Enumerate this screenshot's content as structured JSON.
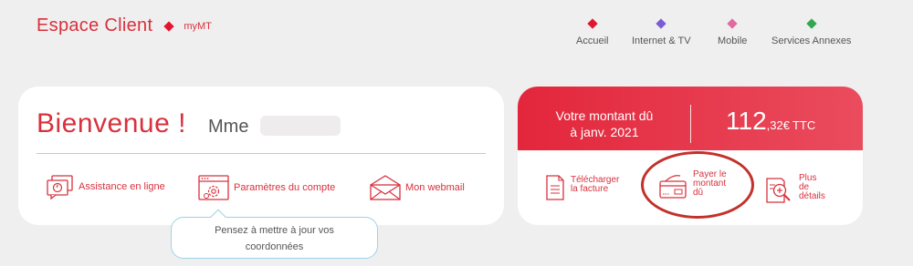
{
  "header": {
    "title": "Espace Client",
    "subtitle": "myMT",
    "brand_color": "#e3162f"
  },
  "nav": {
    "items": [
      {
        "label": "Accueil",
        "color": "#e3162f"
      },
      {
        "label": "Internet & TV",
        "color": "#7b5cd6"
      },
      {
        "label": "Mobile",
        "color": "#e06aa1"
      },
      {
        "label": "Services Annexes",
        "color": "#2fa84f"
      }
    ]
  },
  "welcome": {
    "greeting": "Bienvenue !",
    "salutation": "Mme",
    "links": [
      {
        "label": "Assistance en ligne",
        "icon": "chat-icon"
      },
      {
        "label": "Paramètres du compte",
        "icon": "settings-window-icon"
      },
      {
        "label": "Mon webmail",
        "icon": "envelope-icon"
      }
    ],
    "tooltip": [
      "Pensez à mettre à jour vos",
      "coordonnées"
    ]
  },
  "amount": {
    "label_line1": "Votre montant dû",
    "label_line2": "à janv. 2021",
    "integer": "112",
    "decimal": ",32€",
    "unit": "TTC",
    "header_color": "#e3263b",
    "actions": [
      {
        "lines": [
          "Télécharger",
          "la facture"
        ],
        "icon": "document-icon"
      },
      {
        "lines": [
          "Payer le",
          "montant",
          "dû"
        ],
        "icon": "credit-card-icon"
      },
      {
        "lines": [
          "Plus",
          "de",
          "détails"
        ],
        "icon": "magnify-document-icon"
      }
    ]
  }
}
